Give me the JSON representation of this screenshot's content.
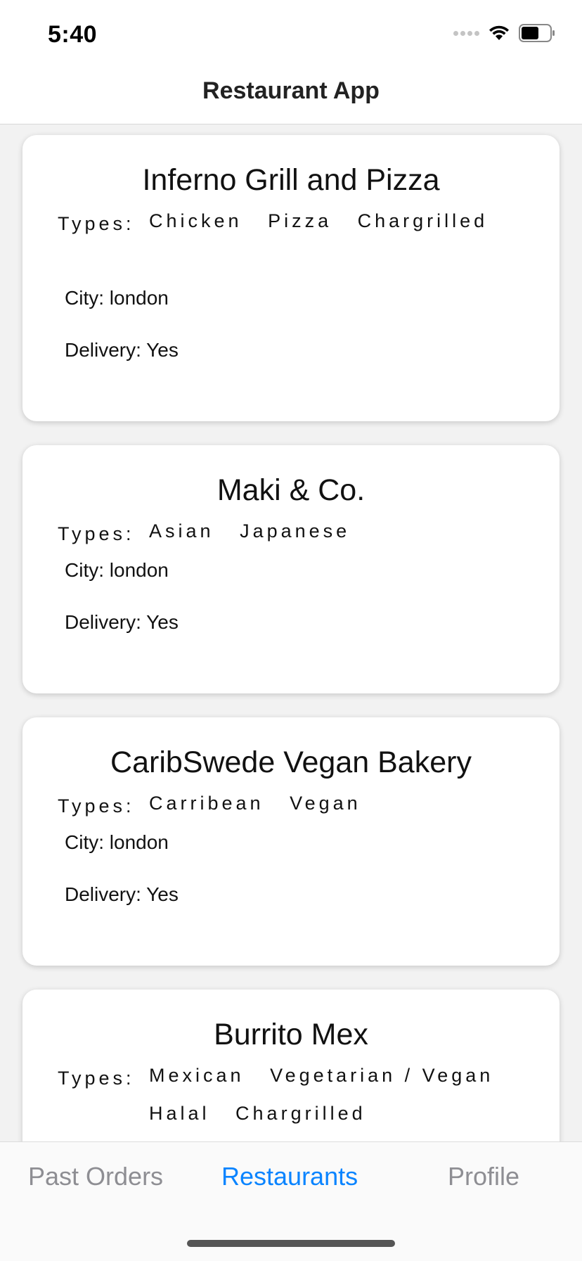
{
  "status_bar": {
    "time": "5:40"
  },
  "header": {
    "title": "Restaurant App"
  },
  "restaurants": [
    {
      "name": "Inferno Grill and Pizza",
      "types_label": "Types:",
      "types": [
        "Chicken",
        "Pizza",
        "Chargrilled"
      ],
      "city": "City: london",
      "delivery": "Delivery: Yes"
    },
    {
      "name": "Maki & Co.",
      "types_label": "Types:",
      "types": [
        "Asian",
        "Japanese"
      ],
      "city": "City: london",
      "delivery": "Delivery: Yes"
    },
    {
      "name": "CaribSwede Vegan Bakery",
      "types_label": "Types:",
      "types": [
        "Carribean",
        "Vegan"
      ],
      "city": "City: london",
      "delivery": "Delivery: Yes"
    },
    {
      "name": "Burrito Mex",
      "types_label": "Types:",
      "types": [
        "Mexican",
        "Vegetarian / Vegan",
        "Halal",
        "Chargrilled"
      ]
    }
  ],
  "tabs": [
    {
      "label": "Past Orders",
      "active": false
    },
    {
      "label": "Restaurants",
      "active": true
    },
    {
      "label": "Profile",
      "active": false
    }
  ],
  "colors": {
    "accent": "#0a84ff",
    "inactive_tab": "#8e8e93",
    "background": "#f2f2f2"
  }
}
